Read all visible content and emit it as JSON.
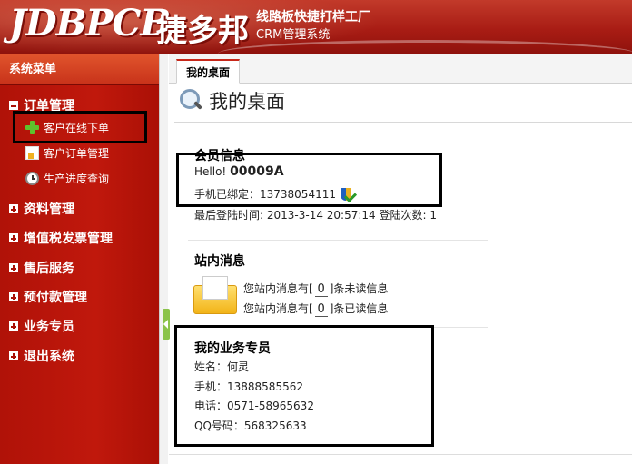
{
  "header": {
    "logo_en": "JDBPCB",
    "logo_cn": "捷多邦",
    "slogan_line1": "线路板快捷打样工厂",
    "slogan_line2": "CRM管理系统"
  },
  "sidebar": {
    "title": "系统菜单",
    "groups": [
      {
        "label": "订单管理",
        "expanded": true
      },
      {
        "label": "资料管理",
        "expanded": false
      },
      {
        "label": "增值税发票管理",
        "expanded": false
      },
      {
        "label": "售后服务",
        "expanded": false
      },
      {
        "label": "预付款管理",
        "expanded": false
      },
      {
        "label": "业务专员",
        "expanded": false
      },
      {
        "label": "退出系统",
        "expanded": false
      }
    ],
    "order_items": [
      {
        "label": "客户在线下单",
        "icon": "plus-icon"
      },
      {
        "label": "客户订单管理",
        "icon": "document-icon"
      },
      {
        "label": "生产进度查询",
        "icon": "clock-icon"
      }
    ]
  },
  "tab": {
    "label": "我的桌面"
  },
  "page": {
    "title": "我的桌面"
  },
  "member": {
    "title": "会员信息",
    "hello_prefix": "Hello!",
    "member_id": "00009A",
    "phone_line": "手机已绑定：13738054111",
    "last_login": "最后登陆时间: 2013-3-14 20:57:14 登陆次数: 1"
  },
  "messages": {
    "title": "站内消息",
    "unread_prefix": "您站内消息有[",
    "unread_count": "0",
    "unread_suffix": "]条未读信息",
    "read_prefix": "您站内消息有[",
    "read_count": "0",
    "read_suffix": "]条已读信息"
  },
  "agent": {
    "title": "我的业务专员",
    "name": "姓名：何灵",
    "mobile": "手机：13888585562",
    "tel": "电话：0571-58965632",
    "qq": "QQ号码：568325633"
  },
  "colors": {
    "brand_red": "#b01208",
    "highlight_box": "#000000"
  }
}
